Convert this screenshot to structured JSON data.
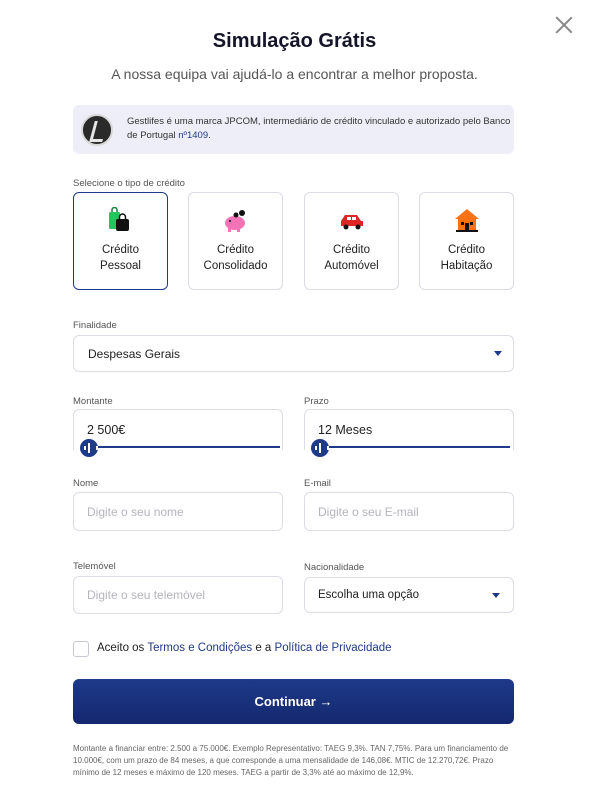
{
  "header": {
    "title": "Simulação Grátis",
    "subtitle": "A nossa equipa vai ajudá-lo a encontrar a melhor proposta."
  },
  "info": {
    "text": "Gestlifes é uma marca JPCOM, intermediário de crédito vinculado e autorizado pelo Banco de Portugal",
    "link": "nº1409",
    "suffix": "."
  },
  "credit_type": {
    "label": "Selecione o tipo de crédito",
    "options": [
      {
        "line1": "Crédito",
        "line2": "Pessoal",
        "icon": "shopping-bag-icon",
        "selected": true
      },
      {
        "line1": "Crédito",
        "line2": "Consolidado",
        "icon": "piggy-bank-icon",
        "selected": false
      },
      {
        "line1": "Crédito",
        "line2": "Automóvel",
        "icon": "car-icon",
        "selected": false
      },
      {
        "line1": "Crédito",
        "line2": "Habitação",
        "icon": "house-icon",
        "selected": false
      }
    ]
  },
  "finalidade": {
    "label": "Finalidade",
    "value": "Despesas Gerais"
  },
  "montante": {
    "label": "Montante",
    "value": "2 500€",
    "slider_fraction": 0.0
  },
  "prazo": {
    "label": "Prazo",
    "value": "12 Meses",
    "slider_fraction": 0.0
  },
  "nome": {
    "label": "Nome",
    "placeholder": "Digite o seu nome"
  },
  "email": {
    "label": "E-mail",
    "placeholder": "Digite o seu E-mail"
  },
  "telemovel": {
    "label": "Telemóvel",
    "placeholder": "Digite o seu telemóvel"
  },
  "nacionalidade": {
    "label": "Nacionalidade",
    "value": "Escolha uma opção"
  },
  "terms": {
    "prefix": "Aceito os",
    "link1": "Termos e Condições",
    "middle": "e a",
    "link2": "Política de Privacidade"
  },
  "submit": {
    "label": "Continuar",
    "arrow": "→"
  },
  "footnote": "Montante a financiar entre: 2.500 a 75.000€. Exemplo Representativo: TAEG 9,3%. TAN 7,75%. Para um financiamento de 10.000€, com um prazo de 84 meses, a que corresponde a uma mensalidade de 146,08€. MTIC de 12.270,72€. Prazo mínimo de 12 meses e máximo de 120 meses. TAEG a partir de 3,3% até ao máximo de 12,9%.",
  "colors": {
    "accent": "#1e3a8a",
    "info_bg": "#eeeef8",
    "border": "#dcdce4"
  }
}
